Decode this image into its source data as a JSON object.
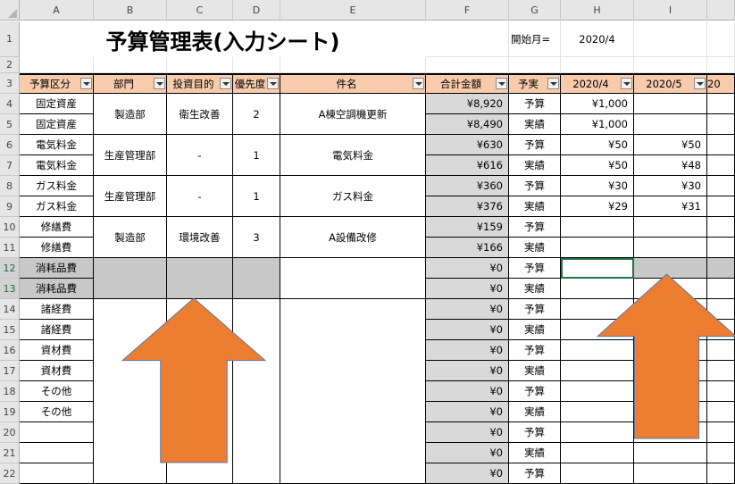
{
  "column_headers": [
    "A",
    "B",
    "C",
    "D",
    "E",
    "F",
    "G",
    "H",
    "I"
  ],
  "row_headers": [
    "1",
    "2",
    "3",
    "4",
    "5",
    "6",
    "7",
    "8",
    "9",
    "10",
    "11",
    "12",
    "13",
    "14",
    "15",
    "16",
    "17",
    "18",
    "19",
    "20",
    "21",
    "22"
  ],
  "title": "予算管理表(入力シート)",
  "start_month_label": "開始月=",
  "start_month_value": "2020/4",
  "table_headers": {
    "category": "予算区分",
    "department": "部門",
    "purpose": "投資目的",
    "priority": "優先度",
    "item": "件名",
    "total": "合計金額",
    "type": "予実",
    "month1": "2020/4",
    "month2": "2020/5",
    "month3_partial": "20"
  },
  "rows": [
    {
      "category": "固定資産",
      "total": "¥8,920",
      "type": "予算",
      "m1": "¥1,000",
      "m2": ""
    },
    {
      "category": "固定資産",
      "total": "¥8,490",
      "type": "実績",
      "m1": "¥1,000",
      "m2": ""
    },
    {
      "category": "電気料金",
      "total": "¥630",
      "type": "予算",
      "m1": "¥50",
      "m2": "¥50"
    },
    {
      "category": "電気料金",
      "total": "¥616",
      "type": "実績",
      "m1": "¥50",
      "m2": "¥48"
    },
    {
      "category": "ガス料金",
      "total": "¥360",
      "type": "予算",
      "m1": "¥30",
      "m2": "¥30"
    },
    {
      "category": "ガス料金",
      "total": "¥376",
      "type": "実績",
      "m1": "¥29",
      "m2": "¥31"
    },
    {
      "category": "修繕費",
      "total": "¥159",
      "type": "予算",
      "m1": "",
      "m2": ""
    },
    {
      "category": "修繕費",
      "total": "¥166",
      "type": "実績",
      "m1": "",
      "m2": ""
    },
    {
      "category": "消耗品費",
      "total": "¥0",
      "type": "予算",
      "m1": "",
      "m2": ""
    },
    {
      "category": "消耗品費",
      "total": "¥0",
      "type": "実績",
      "m1": "",
      "m2": ""
    },
    {
      "category": "諸経費",
      "total": "¥0",
      "type": "予算",
      "m1": "",
      "m2": ""
    },
    {
      "category": "諸経費",
      "total": "¥0",
      "type": "実績",
      "m1": "",
      "m2": ""
    },
    {
      "category": "資材費",
      "total": "¥0",
      "type": "予算",
      "m1": "",
      "m2": ""
    },
    {
      "category": "資材費",
      "total": "¥0",
      "type": "実績",
      "m1": "",
      "m2": ""
    },
    {
      "category": "その他",
      "total": "¥0",
      "type": "予算",
      "m1": "",
      "m2": ""
    },
    {
      "category": "その他",
      "total": "¥0",
      "type": "実績",
      "m1": "",
      "m2": ""
    },
    {
      "category": "",
      "total": "¥0",
      "type": "予算",
      "m1": "",
      "m2": ""
    },
    {
      "category": "",
      "total": "¥0",
      "type": "実績",
      "m1": "",
      "m2": ""
    },
    {
      "category": "",
      "total": "¥0",
      "type": "予算",
      "m1": "",
      "m2": ""
    }
  ],
  "merged_groups": [
    {
      "department": "製造部",
      "purpose": "衛生改善",
      "priority": "2",
      "item": "A棟空調機更新"
    },
    {
      "department": "生産管理部",
      "purpose": "-",
      "priority": "1",
      "item": "電気料金"
    },
    {
      "department": "生産管理部",
      "purpose": "-",
      "priority": "1",
      "item": "ガス料金"
    },
    {
      "department": "製造部",
      "purpose": "環境改善",
      "priority": "3",
      "item": "A設備改修"
    }
  ],
  "colors": {
    "header_fill": "#f8cbad",
    "total_fill": "#d9d9d9",
    "selected_fill": "#c8c8c8",
    "arrow": "#ed7d31",
    "grid_selection": "#217346"
  },
  "annotations": [
    "up-arrow-left",
    "up-arrow-right"
  ]
}
